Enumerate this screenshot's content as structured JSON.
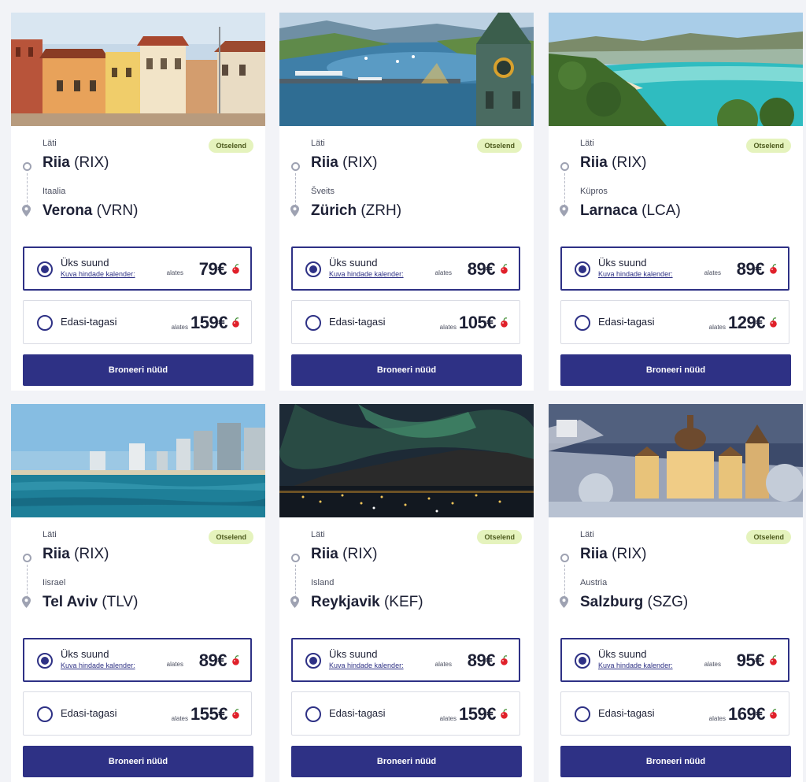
{
  "cards": [
    {
      "origin_country": "Läti",
      "origin_city": "Riia",
      "origin_code": "(RIX)",
      "badge": "Otselend",
      "dest_country": "Itaalia",
      "dest_city": "Verona",
      "dest_code": "(VRN)",
      "one_way_label": "Üks suund",
      "calendar_link": "Kuva hindade kalender:",
      "one_way_from": "alates",
      "one_way_price": "79€",
      "round_trip_label": "Edasi-tagasi",
      "round_trip_from": "alates",
      "round_trip_price": "159€",
      "book_label": "Broneeri nüüd",
      "selected_option": "one_way",
      "photo_icon": "verona-photo"
    },
    {
      "origin_country": "Läti",
      "origin_city": "Riia",
      "origin_code": "(RIX)",
      "badge": "Otselend",
      "dest_country": "Šveits",
      "dest_city": "Zürich",
      "dest_code": "(ZRH)",
      "one_way_label": "Üks suund",
      "calendar_link": "Kuva hindade kalender:",
      "one_way_from": "alates",
      "one_way_price": "89€",
      "round_trip_label": "Edasi-tagasi",
      "round_trip_from": "alates",
      "round_trip_price": "105€",
      "book_label": "Broneeri nüüd",
      "selected_option": "one_way",
      "photo_icon": "zurich-photo"
    },
    {
      "origin_country": "Läti",
      "origin_city": "Riia",
      "origin_code": "(RIX)",
      "badge": "Otselend",
      "dest_country": "Küpros",
      "dest_city": "Larnaca",
      "dest_code": "(LCA)",
      "one_way_label": "Üks suund",
      "calendar_link": "Kuva hindade kalender:",
      "one_way_from": "alates",
      "one_way_price": "89€",
      "round_trip_label": "Edasi-tagasi",
      "round_trip_from": "alates",
      "round_trip_price": "129€",
      "book_label": "Broneeri nüüd",
      "selected_option": "one_way",
      "photo_icon": "larnaca-photo"
    },
    {
      "origin_country": "Läti",
      "origin_city": "Riia",
      "origin_code": "(RIX)",
      "badge": "Otselend",
      "dest_country": "Iisrael",
      "dest_city": "Tel Aviv",
      "dest_code": "(TLV)",
      "one_way_label": "Üks suund",
      "calendar_link": "Kuva hindade kalender:",
      "one_way_from": "alates",
      "one_way_price": "89€",
      "round_trip_label": "Edasi-tagasi",
      "round_trip_from": "alates",
      "round_trip_price": "155€",
      "book_label": "Broneeri nüüd",
      "selected_option": "one_way",
      "photo_icon": "tel-aviv-photo"
    },
    {
      "origin_country": "Läti",
      "origin_city": "Riia",
      "origin_code": "(RIX)",
      "badge": "Otselend",
      "dest_country": "Island",
      "dest_city": "Reykjavik",
      "dest_code": "(KEF)",
      "one_way_label": "Üks suund",
      "calendar_link": "Kuva hindade kalender:",
      "one_way_from": "alates",
      "one_way_price": "89€",
      "round_trip_label": "Edasi-tagasi",
      "round_trip_from": "alates",
      "round_trip_price": "159€",
      "book_label": "Broneeri nüüd",
      "selected_option": "one_way",
      "photo_icon": "reykjavik-photo"
    },
    {
      "origin_country": "Läti",
      "origin_city": "Riia",
      "origin_code": "(RIX)",
      "badge": "Otselend",
      "dest_country": "Austria",
      "dest_city": "Salzburg",
      "dest_code": "(SZG)",
      "one_way_label": "Üks suund",
      "calendar_link": "Kuva hindade kalender:",
      "one_way_from": "alates",
      "one_way_price": "95€",
      "round_trip_label": "Edasi-tagasi",
      "round_trip_from": "alates",
      "round_trip_price": "169€",
      "book_label": "Broneeri nüüd",
      "selected_option": "one_way",
      "photo_icon": "salzburg-photo"
    }
  ],
  "colors": {
    "primary": "#2e3185",
    "badge_bg": "#e5f3bd",
    "cherry_red": "#e0202a",
    "page_bg": "#f2f3f7"
  }
}
